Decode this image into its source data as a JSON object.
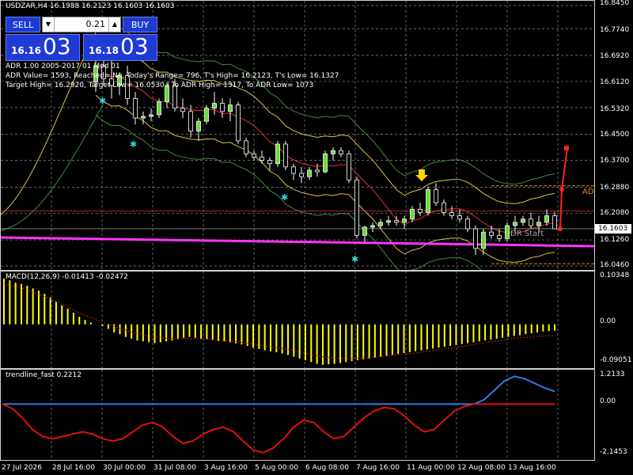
{
  "header": {
    "symbol_line": "USDZAR,H4  16.1988 16.2123 16.1603 16.1603"
  },
  "trade_panel": {
    "sell_label": "SELL",
    "buy_label": "BUY",
    "lot_value": "0.21",
    "bid_prefix": "16.16",
    "bid_big": "03",
    "ask_prefix": "16.18",
    "ask_big": "03"
  },
  "adr_info": {
    "line1": "ADR 1.00 2005-2017 01 Mod 01",
    "line2": "ADR Value= 1593, Reached= No, Today's Range= 796, T's High= 16.2123, T's Low= 16.1327",
    "line3": "Target High= 16.2920, Target Low= 16.0530 / To ADR High= 1317, To ADR Low= 1073"
  },
  "labels": {
    "adr_side": "ADR",
    "dr_start": "DR Start"
  },
  "price_axis": [
    "16.8450",
    "16.7740",
    "16.6920",
    "16.6120",
    "16.5320",
    "16.4500",
    "16.3700",
    "16.2880",
    "16.2080",
    "16.1260",
    "16.0460"
  ],
  "current_price_tag": "16.1603",
  "macd": {
    "title": "MACD(12,26,9) -0.01413 -0.02472",
    "axis": [
      "0.10348",
      "0.00",
      "-0.09051"
    ],
    "histogram": [
      0.102,
      0.098,
      0.093,
      0.09,
      0.086,
      0.08,
      0.075,
      0.068,
      0.06,
      0.05,
      0.042,
      0.035,
      0.026,
      0.017,
      0.01,
      0.004,
      0.0,
      -0.004,
      -0.01,
      -0.018,
      -0.022,
      -0.028,
      -0.032,
      -0.036,
      -0.038,
      -0.04,
      -0.042,
      -0.04,
      -0.038,
      -0.036,
      -0.033,
      -0.03,
      -0.028,
      -0.03,
      -0.032,
      -0.034,
      -0.035,
      -0.037,
      -0.038,
      -0.04,
      -0.042,
      -0.045,
      -0.048,
      -0.052,
      -0.055,
      -0.058,
      -0.06,
      -0.062,
      -0.065,
      -0.068,
      -0.072,
      -0.076,
      -0.08,
      -0.084,
      -0.088,
      -0.09,
      -0.089,
      -0.088,
      -0.086,
      -0.084,
      -0.082,
      -0.08,
      -0.078,
      -0.076,
      -0.074,
      -0.072,
      -0.07,
      -0.068,
      -0.066,
      -0.064,
      -0.062,
      -0.06,
      -0.058,
      -0.056,
      -0.054,
      -0.052,
      -0.05,
      -0.048,
      -0.046,
      -0.044,
      -0.042,
      -0.04,
      -0.038,
      -0.036,
      -0.034,
      -0.032,
      -0.03,
      -0.028,
      -0.026,
      -0.024,
      -0.022,
      -0.02,
      -0.018,
      -0.016,
      -0.015,
      -0.014
    ],
    "signal": [
      0.09,
      0.087,
      0.084,
      0.081,
      0.077,
      0.072,
      0.067,
      0.062,
      0.056,
      0.05,
      0.044,
      0.038,
      0.032,
      0.026,
      0.02,
      0.015,
      0.01,
      0.005,
      0.0,
      -0.005,
      -0.009,
      -0.013,
      -0.017,
      -0.02,
      -0.023,
      -0.026,
      -0.028,
      -0.03,
      -0.031,
      -0.032,
      -0.032,
      -0.032,
      -0.032,
      -0.032,
      -0.033,
      -0.033,
      -0.034,
      -0.035,
      -0.036,
      -0.037,
      -0.038,
      -0.04,
      -0.042,
      -0.044,
      -0.046,
      -0.048,
      -0.05,
      -0.052,
      -0.054,
      -0.056,
      -0.058,
      -0.061,
      -0.064,
      -0.067,
      -0.07,
      -0.072,
      -0.074,
      -0.075,
      -0.076,
      -0.076,
      -0.076,
      -0.076,
      -0.075,
      -0.074,
      -0.073,
      -0.072,
      -0.071,
      -0.07,
      -0.068,
      -0.067,
      -0.065,
      -0.064,
      -0.062,
      -0.06,
      -0.058,
      -0.057,
      -0.055,
      -0.053,
      -0.051,
      -0.049,
      -0.047,
      -0.045,
      -0.043,
      -0.041,
      -0.039,
      -0.037,
      -0.035,
      -0.033,
      -0.031,
      -0.03,
      -0.029,
      -0.028,
      -0.027,
      -0.026,
      -0.025,
      -0.025
    ],
    "bar_color": "#ffff00",
    "signal_color": "#d01818"
  },
  "trendline": {
    "title": "trendline_fast 0.2212",
    "axis": [
      "1.2133",
      "0.00",
      "-2.1453"
    ],
    "red_line": [
      -0.0,
      -0.2,
      -0.6,
      -1.1,
      -1.4,
      -1.5,
      -1.4,
      -1.3,
      -1.2,
      -1.3,
      -1.5,
      -1.6,
      -1.5,
      -1.2,
      -0.9,
      -0.8,
      -1.0,
      -1.4,
      -1.7,
      -1.6,
      -1.3,
      -1.1,
      -1.0,
      -1.2,
      -1.6,
      -2.0,
      -2.1,
      -1.9,
      -1.5,
      -1.0,
      -0.7,
      -0.8,
      -1.2,
      -1.5,
      -1.4,
      -1.0,
      -0.6,
      -0.3,
      -0.15,
      -0.2,
      -0.5,
      -0.9,
      -1.2,
      -1.1,
      -0.7,
      -0.3,
      -0.1,
      -0.0,
      -0.0,
      -0.0,
      -0.0,
      -0.0,
      -0.0,
      -0.0,
      -0.0,
      -0.0
    ],
    "blue_line": [
      0.0,
      0.0,
      0.0,
      0.0,
      0.0,
      0.0,
      0.0,
      0.0,
      0.0,
      0.0,
      0.0,
      0.0,
      0.0,
      0.0,
      0.0,
      0.0,
      0.0,
      0.0,
      0.0,
      0.0,
      0.0,
      0.0,
      0.0,
      0.0,
      0.0,
      0.0,
      0.0,
      0.0,
      0.0,
      0.0,
      0.0,
      0.0,
      0.0,
      0.0,
      0.0,
      0.0,
      0.0,
      0.0,
      0.0,
      0.0,
      0.0,
      0.0,
      0.0,
      0.0,
      0.0,
      0.0,
      0.0,
      0.0,
      0.2,
      0.6,
      1.0,
      1.2,
      1.1,
      0.9,
      0.7,
      0.55
    ],
    "red_color": "#e01010",
    "blue_color": "#2f7ee0"
  },
  "time_axis": [
    "27 Jul 2026",
    "28 Jul 16:00",
    "30 Jul 00:00",
    "31 Jul 08:00",
    "3 Aug 16:00",
    "5 Aug 00:00",
    "6 Aug 08:00",
    "7 Aug 16:00",
    "11 Aug 00:00",
    "12 Aug 08:00",
    "13 Aug 16:00"
  ],
  "chart_data": {
    "type": "candlestick",
    "symbol": "USDZAR",
    "timeframe": "H4",
    "ylim": [
      16.046,
      16.845
    ],
    "candles": [
      [
        16.61,
        16.7,
        16.58,
        16.66
      ],
      [
        16.66,
        16.7,
        16.6,
        16.62
      ],
      [
        16.62,
        16.68,
        16.56,
        16.6
      ],
      [
        16.6,
        16.64,
        16.57,
        16.63
      ],
      [
        16.63,
        16.66,
        16.54,
        16.56
      ],
      [
        16.56,
        16.58,
        16.48,
        16.5
      ],
      [
        16.5,
        16.52,
        16.48,
        16.505
      ],
      [
        16.505,
        16.53,
        16.49,
        16.51
      ],
      [
        16.51,
        16.56,
        16.5,
        16.55
      ],
      [
        16.55,
        16.61,
        16.53,
        16.6
      ],
      [
        16.6,
        16.62,
        16.52,
        16.53
      ],
      [
        16.53,
        16.56,
        16.5,
        16.52
      ],
      [
        16.52,
        16.54,
        16.44,
        16.46
      ],
      [
        16.46,
        16.5,
        16.43,
        16.49
      ],
      [
        16.49,
        16.54,
        16.48,
        16.53
      ],
      [
        16.53,
        16.58,
        16.51,
        16.545
      ],
      [
        16.545,
        16.56,
        16.5,
        16.52
      ],
      [
        16.52,
        16.56,
        16.49,
        16.54
      ],
      [
        16.54,
        16.55,
        16.42,
        16.43
      ],
      [
        16.43,
        16.44,
        16.38,
        16.39
      ],
      [
        16.39,
        16.4,
        16.37,
        16.38
      ],
      [
        16.38,
        16.4,
        16.36,
        16.37
      ],
      [
        16.37,
        16.38,
        16.34,
        16.36
      ],
      [
        16.36,
        16.43,
        16.35,
        16.42
      ],
      [
        16.42,
        16.43,
        16.34,
        16.35
      ],
      [
        16.35,
        16.36,
        16.31,
        16.33
      ],
      [
        16.33,
        16.35,
        16.3,
        16.32
      ],
      [
        16.32,
        16.35,
        16.31,
        16.34
      ],
      [
        16.34,
        16.36,
        16.32,
        16.335
      ],
      [
        16.335,
        16.4,
        16.33,
        16.39
      ],
      [
        16.39,
        16.41,
        16.37,
        16.4
      ],
      [
        16.4,
        16.41,
        16.38,
        16.39
      ],
      [
        16.39,
        16.4,
        16.3,
        16.31
      ],
      [
        16.31,
        16.32,
        16.13,
        16.14
      ],
      [
        16.14,
        16.17,
        16.12,
        16.165
      ],
      [
        16.165,
        16.18,
        16.15,
        16.17
      ],
      [
        16.17,
        16.19,
        16.16,
        16.18
      ],
      [
        16.18,
        16.2,
        16.17,
        16.185
      ],
      [
        16.185,
        16.2,
        16.17,
        16.18
      ],
      [
        16.18,
        16.2,
        16.16,
        16.19
      ],
      [
        16.19,
        16.23,
        16.18,
        16.22
      ],
      [
        16.22,
        16.24,
        16.2,
        16.21
      ],
      [
        16.21,
        16.29,
        16.2,
        16.28
      ],
      [
        16.28,
        16.3,
        16.23,
        16.24
      ],
      [
        16.24,
        16.25,
        16.2,
        16.21
      ],
      [
        16.21,
        16.23,
        16.19,
        16.2
      ],
      [
        16.2,
        16.22,
        16.18,
        16.19
      ],
      [
        16.19,
        16.2,
        16.15,
        16.16
      ],
      [
        16.16,
        16.17,
        16.08,
        16.1
      ],
      [
        16.1,
        16.16,
        16.08,
        16.15
      ],
      [
        16.15,
        16.17,
        16.13,
        16.14
      ],
      [
        16.14,
        16.16,
        16.12,
        16.13
      ],
      [
        16.13,
        16.18,
        16.12,
        16.17
      ],
      [
        16.17,
        16.2,
        16.15,
        16.18
      ],
      [
        16.18,
        16.2,
        16.17,
        16.19
      ],
      [
        16.19,
        16.21,
        16.16,
        16.17
      ],
      [
        16.17,
        16.2,
        16.15,
        16.18
      ],
      [
        16.18,
        16.22,
        16.17,
        16.2
      ],
      [
        16.2,
        16.212,
        16.16,
        16.16
      ]
    ],
    "current_price": 16.1603,
    "adr_target_high": 16.292,
    "adr_target_low": 16.053
  },
  "colors": {
    "bull": "#ffffff",
    "bear": "#ffffff",
    "bull_body": "#66dd33",
    "bear_body": "#000000",
    "magenta": "#ff33ff",
    "red_ma": "#e03030",
    "yellow_band": "#d9c24a",
    "green_band": "#3f8a3f",
    "current_tag_bg": "#ffffff"
  }
}
